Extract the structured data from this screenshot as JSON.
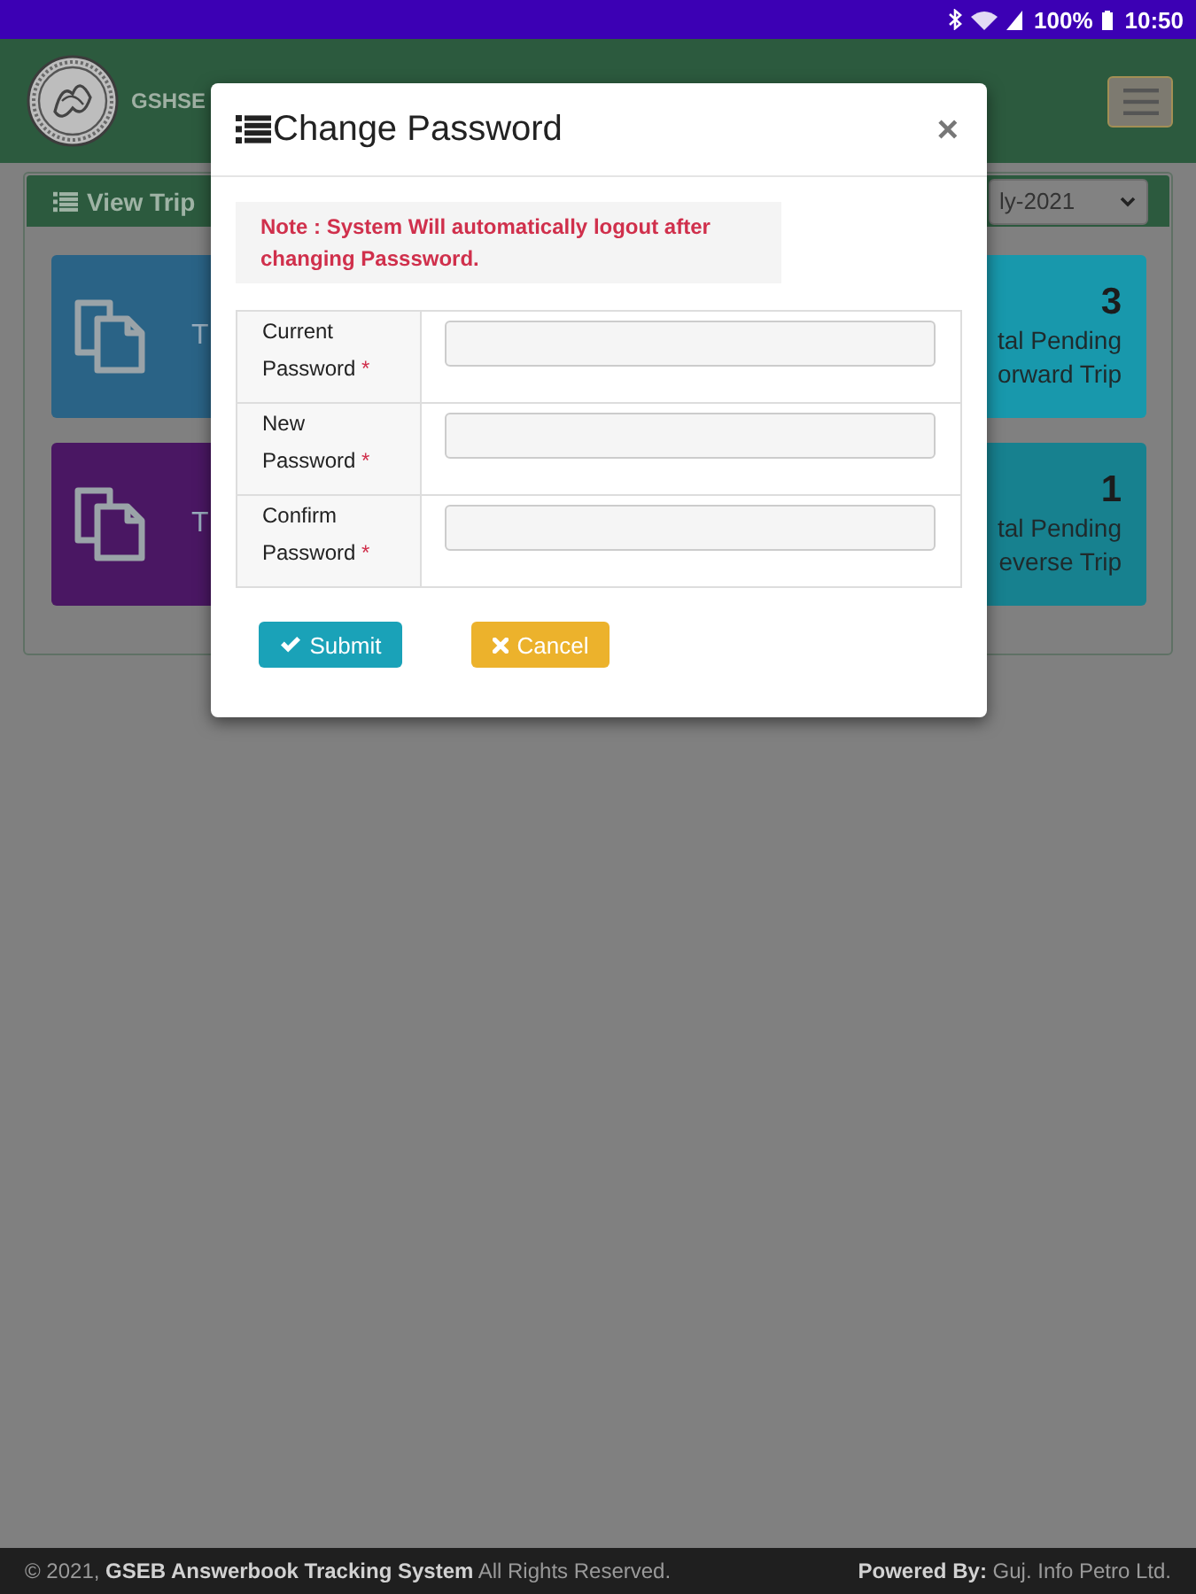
{
  "status_bar": {
    "battery": "100%",
    "time": "10:50"
  },
  "header": {
    "brand": "GSHSE"
  },
  "panel": {
    "title": "View Trip",
    "month": "ly-2021"
  },
  "tiles": [
    {
      "kind": "document",
      "label": "T",
      "color": "#2a6386"
    },
    {
      "kind": "counter",
      "count": "3",
      "lines": [
        "tal Pending",
        "orward Trip"
      ],
      "color": "#1898ac"
    },
    {
      "kind": "document",
      "label": "T",
      "color": "#4a1763"
    },
    {
      "kind": "counter",
      "count": "1",
      "lines": [
        "tal Pending",
        "everse Trip"
      ],
      "color": "#17818f"
    }
  ],
  "dialog": {
    "title": "Change Password",
    "close": "×",
    "note": "Note : System Will automatically logout after changing Passsword.",
    "fields": [
      {
        "label": "Current Password",
        "required_mark": "*"
      },
      {
        "label": "New Password",
        "required_mark": "*"
      },
      {
        "label": "Confirm Password",
        "required_mark": "*"
      }
    ],
    "buttons": [
      {
        "kind": "submit",
        "label": "Submit"
      },
      {
        "kind": "cancel",
        "label": "Cancel"
      }
    ]
  },
  "footer": {
    "copyright": "© 2021, **GSEB Answerbook Tracking System** All Rights Reserved.",
    "powered_by": "**Powered By:** Guj. Info Petro Ltd."
  }
}
